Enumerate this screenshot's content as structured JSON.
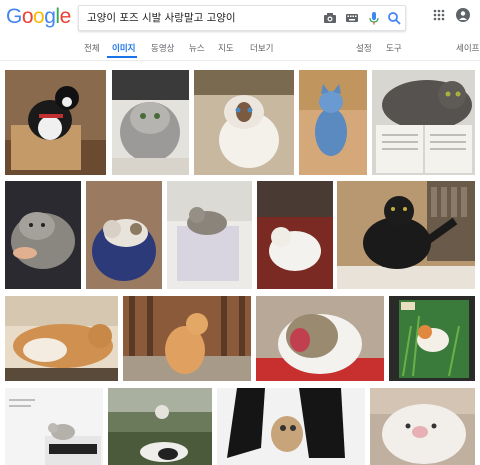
{
  "logo": {
    "letters": [
      "G",
      "o",
      "o",
      "g",
      "l",
      "e"
    ],
    "colors": [
      "#4285f4",
      "#ea4335",
      "#fbbc05",
      "#4285f4",
      "#34a853",
      "#ea4335"
    ]
  },
  "search": {
    "query": "고양이 포즈 시발 사랑말고 고양이"
  },
  "tabs": {
    "all": "전체",
    "images": "이미지",
    "videos": "동영상",
    "news": "뉴스",
    "maps": "지도",
    "more": "더보기",
    "settings": "설정",
    "tools": "도구",
    "safesearch": "세이프서"
  },
  "accent": "#1a73e8",
  "results": [
    {
      "desc": "tuxedo cat in box"
    },
    {
      "desc": "grey tabby cat"
    },
    {
      "desc": "grumpy cat"
    },
    {
      "desc": "blue cat"
    },
    {
      "desc": "grey cat with book"
    },
    {
      "desc": "tabby lying"
    },
    {
      "desc": "white tabby on rug"
    },
    {
      "desc": "tabby on stool"
    },
    {
      "desc": "white cat lying"
    },
    {
      "desc": "black cat standing"
    },
    {
      "desc": "orange tabby lying"
    },
    {
      "desc": "orange cat sitting"
    },
    {
      "desc": "cat yawning"
    },
    {
      "desc": "cat painting"
    },
    {
      "desc": "cat on printer"
    },
    {
      "desc": "cat outdoors"
    },
    {
      "desc": "kitten with boots"
    },
    {
      "desc": "white kitten"
    }
  ]
}
